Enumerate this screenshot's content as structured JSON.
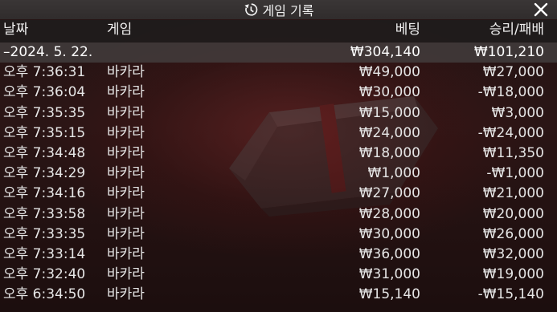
{
  "title": "게임 기록",
  "header": {
    "date": "날짜",
    "game": "게임",
    "bet": "베팅",
    "winloss": "승리/패배"
  },
  "date_group": {
    "date": "–2024. 5. 22.",
    "bet": "₩304,140",
    "winloss": "₩101,210"
  },
  "rows": [
    {
      "time": "오후 7:36:31",
      "game": "바카라",
      "bet": "₩49,000",
      "winloss": "₩27,000"
    },
    {
      "time": "오후 7:36:04",
      "game": "바카라",
      "bet": "₩30,000",
      "winloss": "-₩18,000"
    },
    {
      "time": "오후 7:35:35",
      "game": "바카라",
      "bet": "₩15,000",
      "winloss": "₩3,000"
    },
    {
      "time": "오후 7:35:15",
      "game": "바카라",
      "bet": "₩24,000",
      "winloss": "-₩24,000"
    },
    {
      "time": "오후 7:34:48",
      "game": "바카라",
      "bet": "₩18,000",
      "winloss": "₩11,350"
    },
    {
      "time": "오후 7:34:29",
      "game": "바카라",
      "bet": "₩1,000",
      "winloss": "-₩1,000"
    },
    {
      "time": "오후 7:34:16",
      "game": "바카라",
      "bet": "₩27,000",
      "winloss": "₩21,000"
    },
    {
      "time": "오후 7:33:58",
      "game": "바카라",
      "bet": "₩28,000",
      "winloss": "₩20,000"
    },
    {
      "time": "오후 7:33:35",
      "game": "바카라",
      "bet": "₩30,000",
      "winloss": "₩26,000"
    },
    {
      "time": "오후 7:33:14",
      "game": "바카라",
      "bet": "₩36,000",
      "winloss": "₩32,000"
    },
    {
      "time": "오후 7:32:40",
      "game": "바카라",
      "bet": "₩31,000",
      "winloss": "₩19,000"
    },
    {
      "time": "오후 6:34:50",
      "game": "바카라",
      "bet": "₩15,140",
      "winloss": "-₩15,140"
    }
  ],
  "icons": {
    "history": "history-icon",
    "close": "close-icon"
  },
  "colors": {
    "titlebar": "#332f2f",
    "date_row": "#464242",
    "text": "#e9e9e9"
  }
}
